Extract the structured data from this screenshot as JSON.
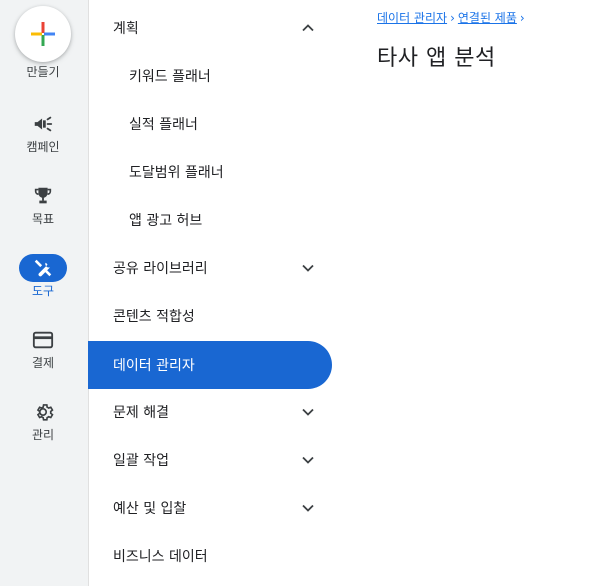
{
  "rail": {
    "create_label": "만들기",
    "items": [
      {
        "label": "캠페인",
        "icon": "megaphone-icon"
      },
      {
        "label": "목표",
        "icon": "trophy-icon"
      },
      {
        "label": "도구",
        "icon": "tools-icon",
        "active": true
      },
      {
        "label": "결제",
        "icon": "credit-card-icon"
      },
      {
        "label": "관리",
        "icon": "gear-icon"
      }
    ]
  },
  "menu": {
    "items": [
      {
        "label": "계획",
        "chevron": "up"
      },
      {
        "label": "키워드 플래너"
      },
      {
        "label": "실적 플래너"
      },
      {
        "label": "도달범위 플래너"
      },
      {
        "label": "앱 광고 허브"
      },
      {
        "label": "공유 라이브러리",
        "chevron": "down"
      },
      {
        "label": "콘텐츠 적합성"
      },
      {
        "label": "데이터 관리자",
        "active": true
      },
      {
        "label": "문제 해결",
        "chevron": "down"
      },
      {
        "label": "일괄 작업",
        "chevron": "down"
      },
      {
        "label": "예산 및 입찰",
        "chevron": "down"
      },
      {
        "label": "비즈니스 데이터"
      }
    ]
  },
  "breadcrumb": {
    "items": [
      "데이터 관리자",
      "연결된 제품"
    ],
    "separator": "›"
  },
  "page": {
    "title": "타사 앱 분석"
  },
  "colors": {
    "accent": "#1967d2",
    "link": "#1a73e8",
    "rail_bg": "#f1f3f4"
  }
}
